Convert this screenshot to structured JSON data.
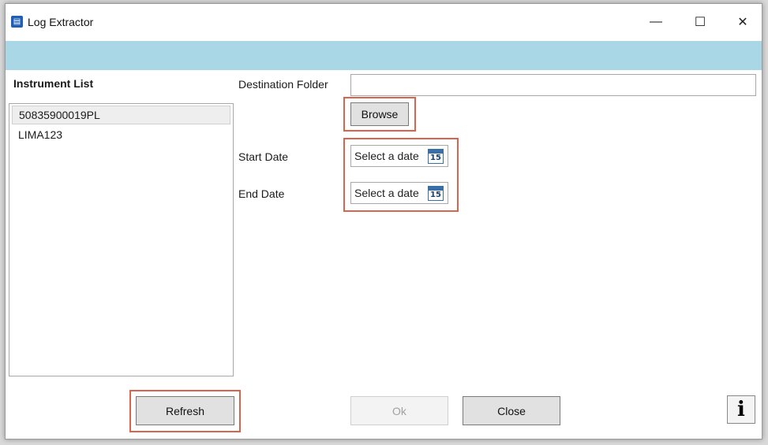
{
  "window": {
    "title": "Log Extractor",
    "controls": {
      "minimize": "—",
      "maximize": "☐",
      "close": "✕"
    }
  },
  "colors": {
    "banner": "#a9d7e6",
    "highlight": "#d9644b",
    "app_icon": "#1f5fb5"
  },
  "instruments": {
    "label": "Instrument List",
    "items": [
      "50835900019PL",
      "LIMA123"
    ],
    "selected_index": 0
  },
  "form": {
    "destination_label": "Destination Folder",
    "destination_value": "",
    "browse_label": "Browse",
    "start_date_label": "Start Date",
    "start_date_placeholder": "Select a date",
    "end_date_label": "End Date",
    "end_date_placeholder": "Select a date",
    "calendar_day": "15"
  },
  "footer": {
    "refresh_label": "Refresh",
    "ok_label": "Ok",
    "close_label": "Close",
    "info_label": "i"
  }
}
